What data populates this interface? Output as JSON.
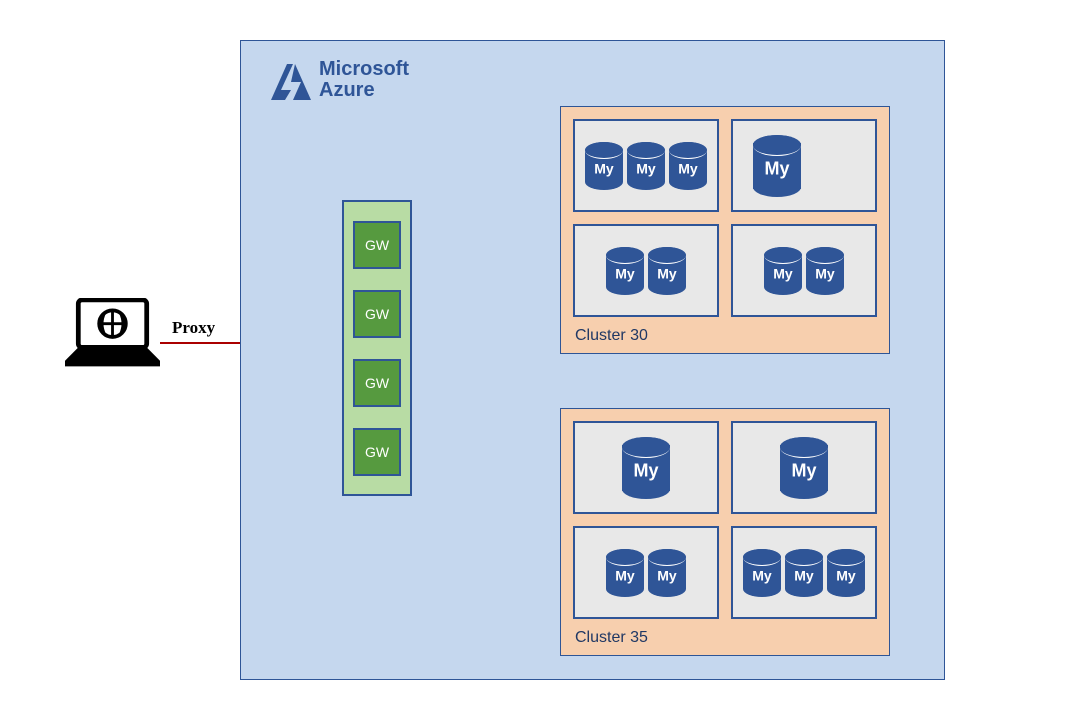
{
  "brand": {
    "line1": "Microsoft",
    "line2": "Azure"
  },
  "connection_label": "Proxy",
  "gateways": [
    "GW",
    "GW",
    "GW",
    "GW"
  ],
  "db_label": "My",
  "clusters": [
    {
      "id": "cluster-30",
      "label": "Cluster 30",
      "pods": [
        {
          "dbs": [
            "small",
            "small",
            "small"
          ]
        },
        {
          "dbs": [
            "large"
          ],
          "target": true,
          "align": "start"
        },
        {
          "dbs": [
            "small",
            "small"
          ]
        },
        {
          "dbs": [
            "small",
            "small"
          ]
        }
      ]
    },
    {
      "id": "cluster-35",
      "label": "Cluster 35",
      "pods": [
        {
          "dbs": [
            "large"
          ]
        },
        {
          "dbs": [
            "large"
          ]
        },
        {
          "dbs": [
            "small",
            "small"
          ]
        },
        {
          "dbs": [
            "small",
            "small",
            "small"
          ]
        }
      ]
    }
  ],
  "connections": [
    {
      "from": "laptop",
      "to": "gateway-2"
    },
    {
      "from": "gateway-2",
      "to": "cluster-30-pod-1-db-0"
    }
  ],
  "colors": {
    "azure_bg": "#c5d7ee",
    "azure_border": "#2f5597",
    "gw_bg": "#569a3f",
    "gw_stack_bg": "#b8dca4",
    "cluster_bg": "#f7cfae",
    "pod_bg": "#e8e8e8",
    "db_fill": "#2f5597",
    "conn_line": "#aa0000"
  }
}
